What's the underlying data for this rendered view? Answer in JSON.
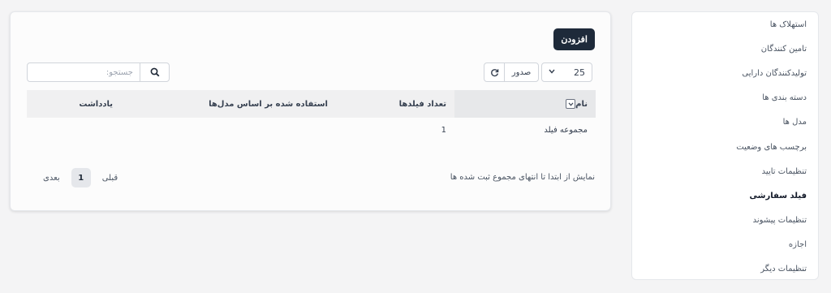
{
  "toolbar": {
    "add_label": "افزودن",
    "per_page_value": "25",
    "export_label": "صدور",
    "refresh_icon": "refresh-icon",
    "search_placeholder": "جستجو:",
    "search_icon": "search-icon"
  },
  "table": {
    "columns": [
      "نام",
      "تعداد فیلدها",
      "استفاده شده بر اساس مدل‌ها",
      "یادداشت"
    ],
    "rows": [
      {
        "name": "مجموعه فیلد",
        "field_count": "1",
        "used_by_models": "",
        "notes": ""
      }
    ]
  },
  "footer": {
    "info": "نمایش از ابتدا تا انتهای مجموع ثبت شده ها",
    "prev_label": "قبلی",
    "current_page": "1",
    "next_label": "بعدی"
  },
  "sidebar": {
    "items": [
      {
        "label": "استهلاک ها",
        "active": false
      },
      {
        "label": "تامین کنندگان",
        "active": false
      },
      {
        "label": "تولیدکنندگان دارایی",
        "active": false
      },
      {
        "label": "دسته بندی ها",
        "active": false
      },
      {
        "label": "مدل ها",
        "active": false
      },
      {
        "label": "برچسب های وضعیت",
        "active": false
      },
      {
        "label": "تنظیمات تایید",
        "active": false
      },
      {
        "label": "فیلد سفارشی",
        "active": true
      },
      {
        "label": "تنظیمات پیشوند",
        "active": false
      },
      {
        "label": "اجازه",
        "active": false
      },
      {
        "label": "تنظیمات دیگر",
        "active": false
      }
    ]
  }
}
